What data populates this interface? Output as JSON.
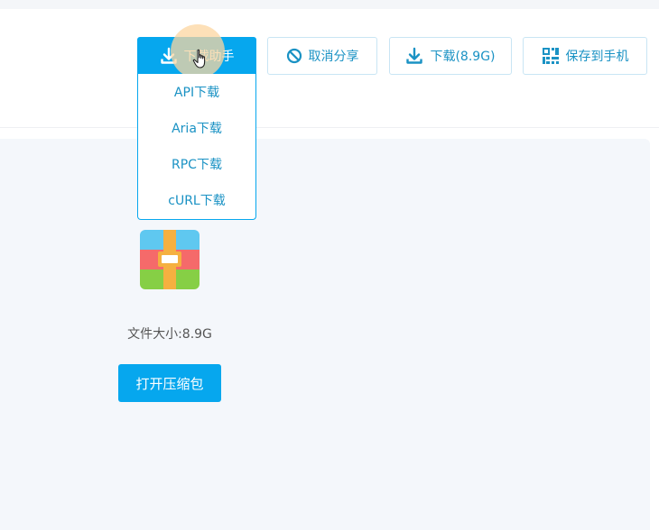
{
  "toolbar": {
    "helper_label": "下载助手",
    "cancel_share_label": "取消分享",
    "download_label": "下载(8.9G)",
    "save_to_phone_label": "保存到手机"
  },
  "download_helper_menu": {
    "items": [
      "API下载",
      "Aria下载",
      "RPC下载",
      "cURL下载"
    ]
  },
  "file": {
    "icon": "archive-icon",
    "size_text": "文件大小:8.9G",
    "open_button_label": "打开压缩包"
  },
  "colors": {
    "accent": "#06a7ee",
    "accent_text": "#1a92c4",
    "panel_bg": "#f4f7fb"
  }
}
